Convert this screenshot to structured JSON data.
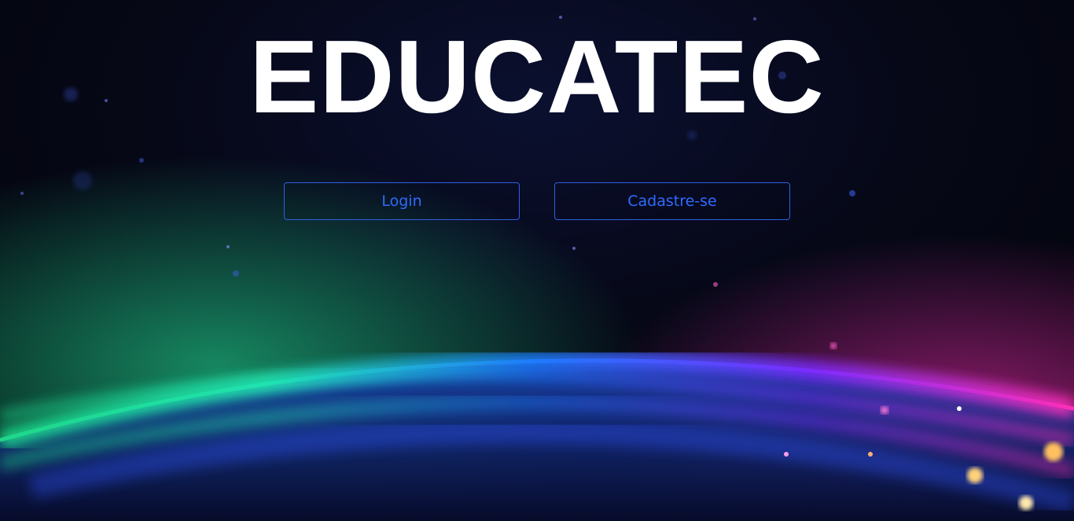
{
  "header": {
    "title": "EDUCATEC"
  },
  "actions": {
    "login_label": "Login",
    "signup_label": "Cadastre-se"
  },
  "theme": {
    "background": "#05060f",
    "accent": "#2f6bff",
    "title_color": "#ffffff"
  }
}
